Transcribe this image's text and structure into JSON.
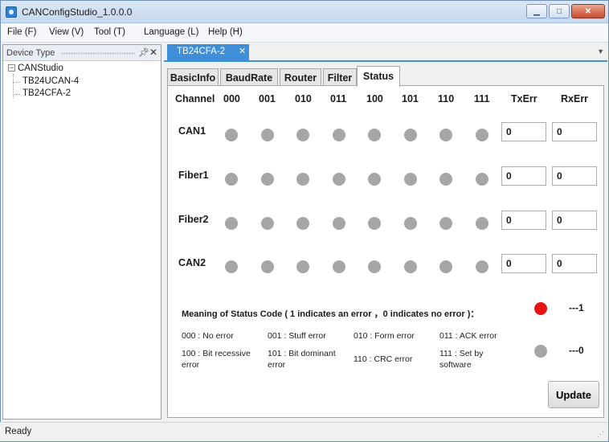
{
  "window": {
    "title": "CANConfigStudio_1.0.0.0"
  },
  "menu": [
    "File (F)",
    "View (V)",
    "Tool (T)",
    "Language (L)",
    "Help (H)"
  ],
  "device_pane": {
    "title": "Device Type",
    "pin": "ᵖ",
    "close": "✕",
    "root": "CANStudio",
    "children": [
      "TB24UCAN-4",
      "TB24CFA-2"
    ]
  },
  "doc_tab": {
    "label": "TB24CFA-2",
    "close": "✕"
  },
  "tabs": [
    "BasicInfo",
    "BaudRate",
    "Router",
    "Filter",
    "Status"
  ],
  "active_tab": "Status",
  "columns": {
    "channel": "Channel",
    "codes": [
      "000",
      "001",
      "010",
      "011",
      "100",
      "101",
      "110",
      "111"
    ],
    "txerr": "TxErr",
    "rxerr": "RxErr"
  },
  "rows": [
    {
      "label": "CAN1",
      "leds": [
        0,
        0,
        0,
        0,
        0,
        0,
        0,
        0
      ],
      "txerr": "0",
      "rxerr": "0"
    },
    {
      "label": "Fiber1",
      "leds": [
        0,
        0,
        0,
        0,
        0,
        0,
        0,
        0
      ],
      "txerr": "0",
      "rxerr": "0"
    },
    {
      "label": "Fiber2",
      "leds": [
        0,
        0,
        0,
        0,
        0,
        0,
        0,
        0
      ],
      "txerr": "0",
      "rxerr": "0"
    },
    {
      "label": "CAN2",
      "leds": [
        0,
        0,
        0,
        0,
        0,
        0,
        0,
        0
      ],
      "txerr": "0",
      "rxerr": "0"
    }
  ],
  "meaning": {
    "title": "Meaning of Status Code ( 1 indicates an error ，0 indicates no error )：",
    "codes": [
      "000 : No error",
      "001 : Stuff error",
      "010 : Form error",
      "011 : ACK error",
      "100 : Bit recessive error",
      "101 : Bit dominant error",
      "110 : CRC error",
      "111 : Set by software"
    ]
  },
  "legend": [
    {
      "color": "#e81313",
      "value": "---1"
    },
    {
      "color": "#a6a6a6",
      "value": "---0"
    }
  ],
  "colors": {
    "led_off": "#a6a6a6",
    "led_on": "#e81313",
    "accent": "#3e8fd8"
  },
  "update_button": "Update",
  "status": "Ready"
}
